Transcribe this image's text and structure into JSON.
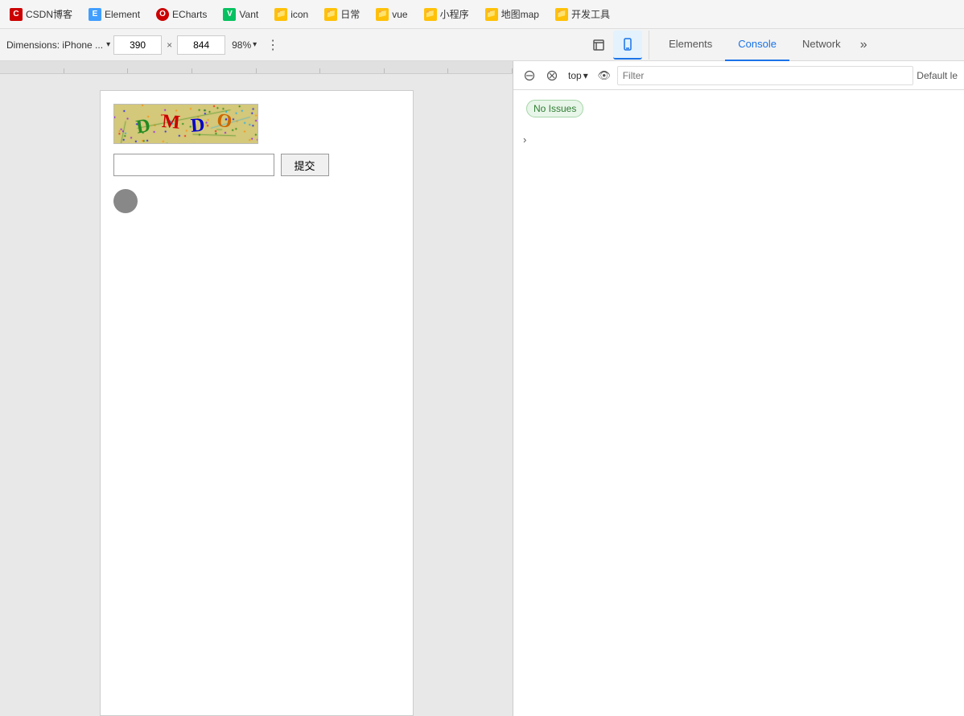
{
  "bookmarks": {
    "items": [
      {
        "id": "csdn",
        "label": "CSDN博客",
        "icon_char": "C",
        "icon_class": "icon-csdn"
      },
      {
        "id": "element",
        "label": "Element",
        "icon_char": "E",
        "icon_class": "icon-element"
      },
      {
        "id": "echarts",
        "label": "ECharts",
        "icon_char": "O",
        "icon_class": "icon-echarts"
      },
      {
        "id": "vant",
        "label": "Vant",
        "icon_char": "V",
        "icon_class": "icon-vant"
      },
      {
        "id": "icon",
        "label": "icon",
        "icon_char": "📁",
        "icon_class": "icon-folder"
      },
      {
        "id": "daily",
        "label": "日常",
        "icon_char": "📁",
        "icon_class": "icon-folder"
      },
      {
        "id": "vue",
        "label": "vue",
        "icon_char": "📁",
        "icon_class": "icon-folder"
      },
      {
        "id": "miniapp",
        "label": "小程序",
        "icon_char": "📁",
        "icon_class": "icon-folder"
      },
      {
        "id": "map",
        "label": "地图map",
        "icon_char": "📁",
        "icon_class": "icon-folder"
      },
      {
        "id": "devtools",
        "label": "开发工具",
        "icon_char": "📁",
        "icon_class": "icon-folder"
      }
    ]
  },
  "toolbar": {
    "dimensions_label": "Dimensions: iPhone ...",
    "width_value": "390",
    "height_value": "844",
    "zoom_value": "98%",
    "dots_icon": "⋮"
  },
  "captcha": {
    "letters": [
      "D",
      "M",
      "D",
      "O"
    ],
    "input_placeholder": "",
    "submit_label": "提交"
  },
  "devtools": {
    "tabs": [
      {
        "id": "elements",
        "label": "Elements",
        "active": false
      },
      {
        "id": "console",
        "label": "Console",
        "active": true
      },
      {
        "id": "network",
        "label": "Network",
        "active": false
      }
    ],
    "more_tabs_icon": "»",
    "console_bar": {
      "top_label": "top",
      "dropdown_icon": "▾",
      "eye_icon": "👁",
      "filter_placeholder": "Filter",
      "default_level_label": "Default le"
    },
    "no_issues_label": "No Issues",
    "expand_arrow": "›"
  }
}
